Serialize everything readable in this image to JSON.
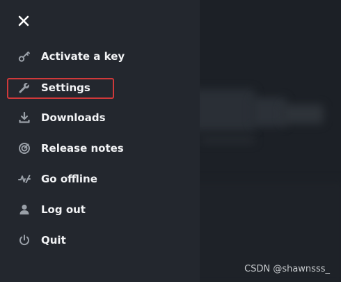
{
  "menu": {
    "close_icon": "close-icon",
    "items": [
      {
        "label": "Activate a key",
        "icon": "key-icon"
      },
      {
        "label": "Settings",
        "icon": "wrench-icon"
      },
      {
        "label": "Downloads",
        "icon": "download-icon"
      },
      {
        "label": "Release notes",
        "icon": "release-notes-icon"
      },
      {
        "label": "Go offline",
        "icon": "offline-icon"
      },
      {
        "label": "Log out",
        "icon": "user-icon"
      },
      {
        "label": "Quit",
        "icon": "power-icon"
      }
    ]
  },
  "annotation": {
    "highlighted_item": "Settings",
    "highlight_color": "#d0393a"
  },
  "watermark": "CSDN @shawnsss_",
  "colors": {
    "menu_bg": "#23272e",
    "text": "#f2f3f5",
    "icon": "#9aa0a8"
  }
}
